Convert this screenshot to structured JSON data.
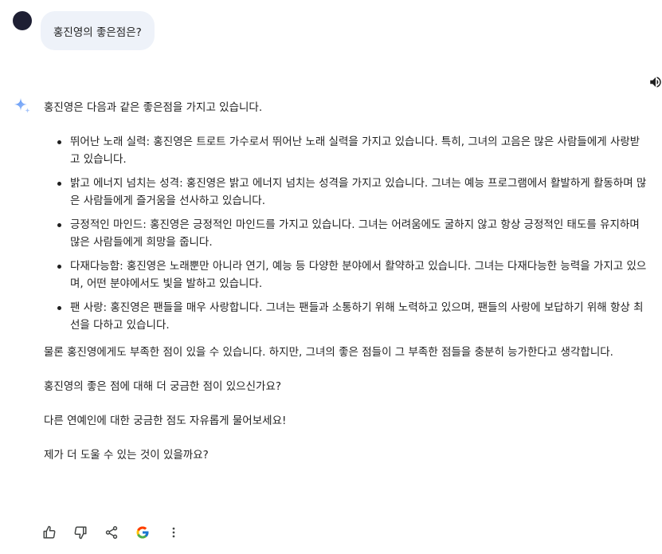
{
  "prompt": {
    "text": "홍진영의 좋은점은?"
  },
  "response": {
    "intro": "홍진영은 다음과 같은 좋은점을 가지고 있습니다.",
    "points": [
      "뛰어난 노래 실력: 홍진영은 트로트 가수로서 뛰어난 노래 실력을 가지고 있습니다. 특히, 그녀의 고음은 많은 사람들에게 사랑받고 있습니다.",
      "밝고 에너지 넘치는 성격: 홍진영은 밝고 에너지 넘치는 성격을 가지고 있습니다. 그녀는 예능 프로그램에서 활발하게 활동하며 많은 사람들에게 즐거움을 선사하고 있습니다.",
      "긍정적인 마인드: 홍진영은 긍정적인 마인드를 가지고 있습니다. 그녀는 어려움에도 굴하지 않고 항상 긍정적인 태도를 유지하며 많은 사람들에게 희망을 줍니다.",
      "다재다능함: 홍진영은 노래뿐만 아니라 연기, 예능 등 다양한 분야에서 활약하고 있습니다. 그녀는 다재다능한 능력을 가지고 있으며, 어떤 분야에서도 빛을 발하고 있습니다.",
      "팬 사랑: 홍진영은 팬들을 매우 사랑합니다. 그녀는 팬들과 소통하기 위해 노력하고 있으며, 팬들의 사랑에 보답하기 위해 항상 최선을 다하고 있습니다."
    ],
    "closing": "물론 홍진영에게도 부족한 점이 있을 수 있습니다. 하지만, 그녀의 좋은 점들이 그 부족한 점들을 충분히 능가한다고 생각합니다.",
    "question": "홍진영의 좋은 점에 대해 더 궁금한 점이 있으신가요?",
    "suggestion": "다른 연예인에 대한 궁금한 점도 자유롭게 물어보세요!",
    "offer": "제가 더 도울 수 있는 것이 있을까요?"
  },
  "icons": {
    "avatar": "user-avatar",
    "sparkle": "gemini-sparkle-icon",
    "speaker": "speaker-icon",
    "actions": [
      "thumbs-up-icon",
      "thumbs-down-icon",
      "share-icon",
      "google-icon",
      "more-vert-icon"
    ]
  },
  "colors": {
    "bubble_bg": "#eef2f9",
    "avatar": "#1e1f33",
    "sparkle_blue": "#4285f4",
    "text": "#1f1f1f",
    "icon": "#444746"
  }
}
